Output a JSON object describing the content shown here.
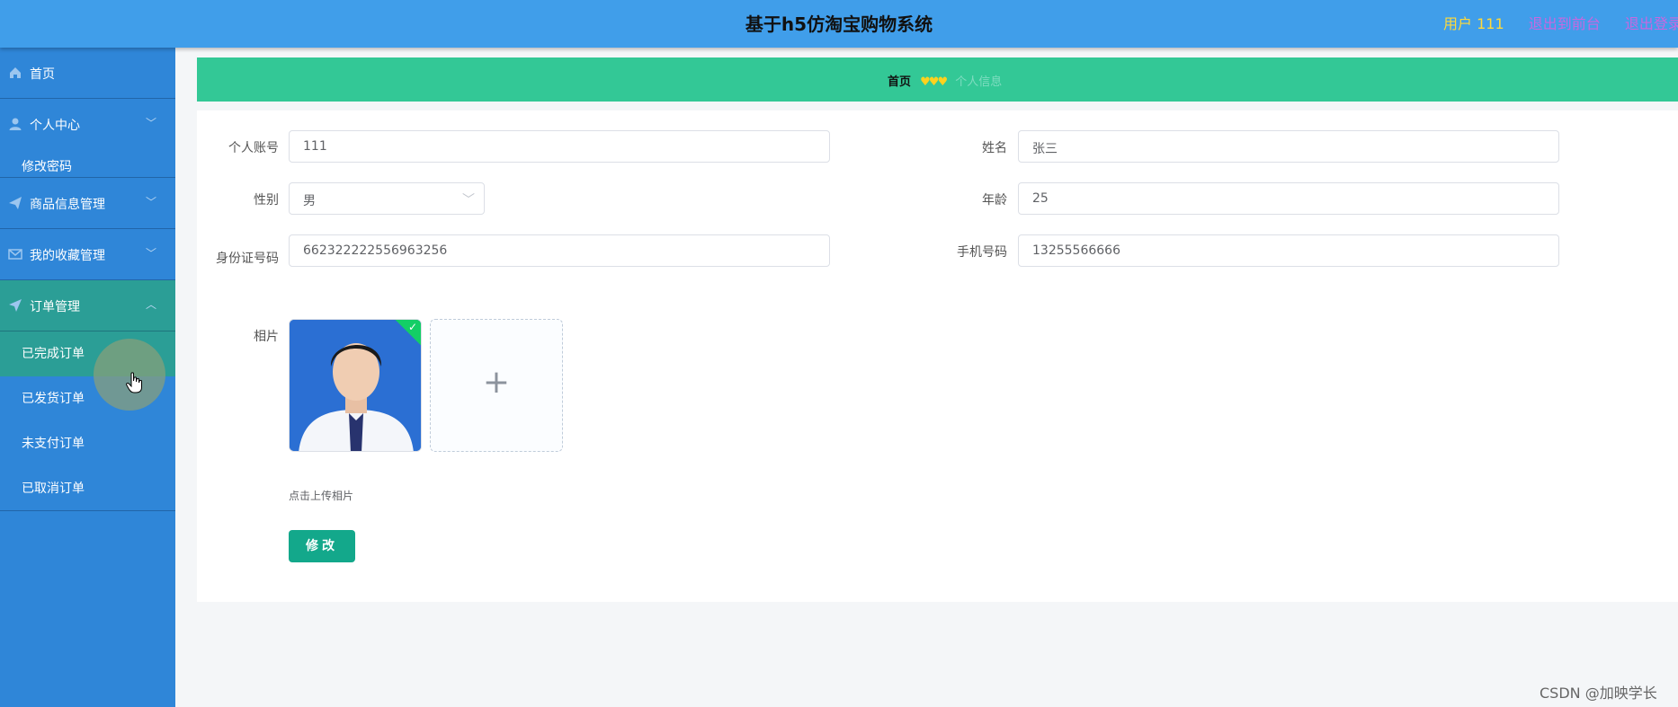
{
  "header": {
    "title": "基于h5仿淘宝购物系统",
    "user_label": "用户 111",
    "to_front_label": "退出到前台",
    "logout_label": "退出登录"
  },
  "sidebar": {
    "items": [
      {
        "label": "首页",
        "icon": "home-icon"
      },
      {
        "label": "个人中心",
        "icon": "user-icon",
        "sub": [
          "修改密码"
        ]
      },
      {
        "label": "商品信息管理",
        "icon": "send-icon"
      },
      {
        "label": "我的收藏管理",
        "icon": "mail-icon"
      },
      {
        "label": "订单管理",
        "icon": "navigation-icon",
        "sub": [
          "已完成订单",
          "已发货订单",
          "未支付订单",
          "已取消订单"
        ]
      }
    ]
  },
  "breadcrumb": {
    "home": "首页",
    "separator": "♥♥♥",
    "current": "个人信息"
  },
  "form": {
    "account_label": "个人账号",
    "account_value": "111",
    "name_label": "姓名",
    "name_value": "张三",
    "gender_label": "性别",
    "gender_value": "男",
    "age_label": "年龄",
    "age_value": "25",
    "id_label": "身份证号码",
    "id_value": "662322222556963256",
    "phone_label": "手机号码",
    "phone_value": "13255566666",
    "photo_label": "相片",
    "upload_hint": "点击上传相片",
    "submit_label": "修改"
  },
  "watermark": "CSDN @加映学长",
  "colors": {
    "header_bg": "#409eea",
    "sidebar_bg": "#2f86d8",
    "breadcrumb_bg": "#33c896",
    "button_bg": "#13a88b"
  }
}
